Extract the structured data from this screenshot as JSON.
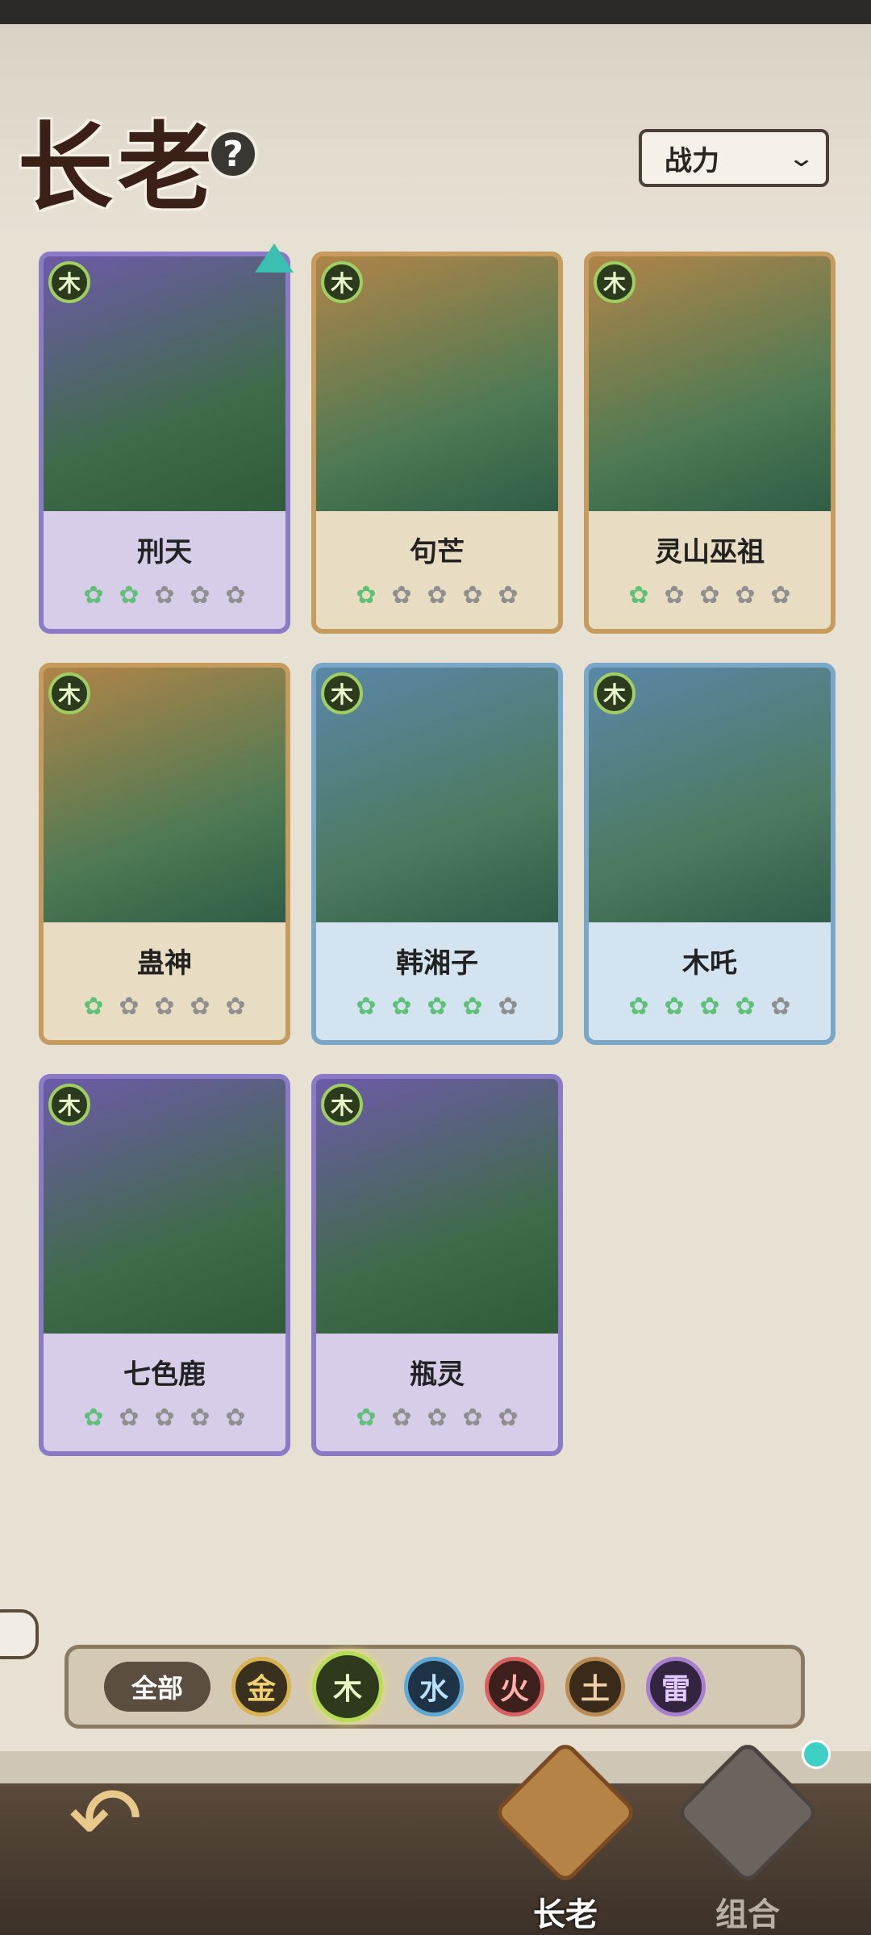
{
  "header": {
    "title": "长老",
    "sort_label": "战力"
  },
  "element_badge": "木",
  "characters": [
    {
      "name": "刑天",
      "frame": "purple",
      "stars_filled": 2,
      "stars_total": 5
    },
    {
      "name": "句芒",
      "frame": "gold",
      "stars_filled": 1,
      "stars_total": 5
    },
    {
      "name": "灵山巫祖",
      "frame": "gold",
      "stars_filled": 1,
      "stars_total": 5
    },
    {
      "name": "蛊神",
      "frame": "gold",
      "stars_filled": 1,
      "stars_total": 5
    },
    {
      "name": "韩湘子",
      "frame": "blue",
      "stars_filled": 4,
      "stars_total": 5
    },
    {
      "name": "木吒",
      "frame": "blue",
      "stars_filled": 4,
      "stars_total": 5
    },
    {
      "name": "七色鹿",
      "frame": "purple",
      "stars_filled": 1,
      "stars_total": 5
    },
    {
      "name": "瓶灵",
      "frame": "purple",
      "stars_filled": 1,
      "stars_total": 5
    }
  ],
  "filters": {
    "all": "全部",
    "elements": [
      "金",
      "木",
      "水",
      "火",
      "土",
      "雷"
    ],
    "selected": "木"
  },
  "nav": {
    "elder": "长老",
    "combo": "组合"
  }
}
